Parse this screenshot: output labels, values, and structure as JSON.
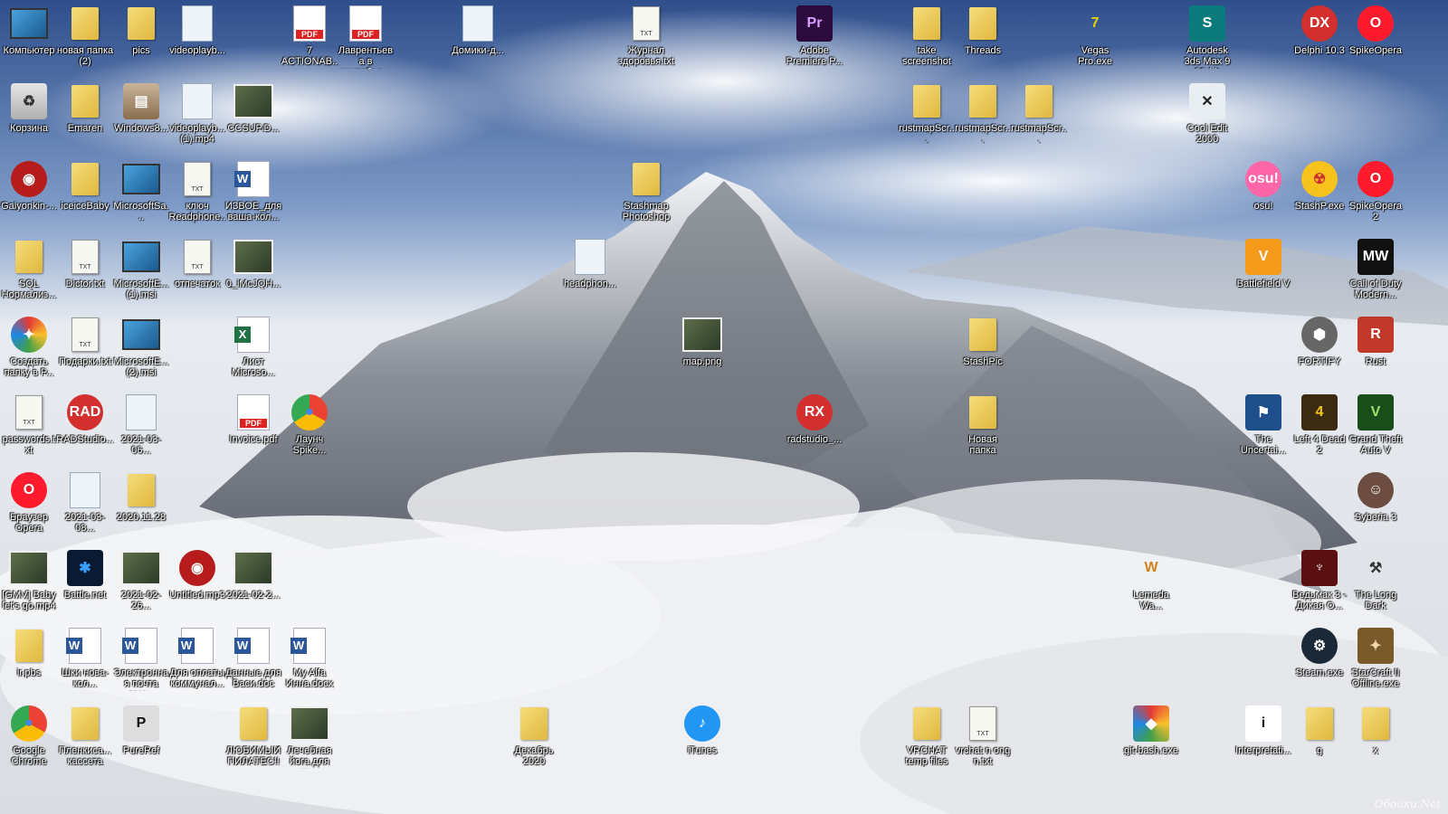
{
  "desktop": {
    "watermark": "Обойки.Net",
    "icons": [
      {
        "label": "Компьютер",
        "icon": "computer-icon"
      },
      {
        "label": "новая папка (2)",
        "icon": "folder-icon"
      },
      {
        "label": "pics",
        "icon": "folder-icon"
      },
      {
        "label": "videoplayb...",
        "icon": "video-file-icon"
      },
      {
        "label": "7 ACTIONAB...",
        "icon": "pdf-icon"
      },
      {
        "label": "Лаврентьева в сентябре...",
        "icon": "pdf-icon"
      },
      {
        "label": "Домики-д...",
        "icon": "presentation-icon"
      },
      {
        "label": "Журнал здоровья.txt",
        "icon": "txt-icon"
      },
      {
        "label": "Adobe Premiere P...",
        "icon": "premiere-icon"
      },
      {
        "label": "take screenshot",
        "icon": "folder-icon"
      },
      {
        "label": "Threads",
        "icon": "folder-icon"
      },
      {
        "label": "Vegas Pro.exe",
        "icon": "vegas-icon"
      },
      {
        "label": "Autodesk 3ds Max 9 32-bit",
        "icon": "3dsmax-icon"
      },
      {
        "label": "Delphi 10.3",
        "icon": "delphi-icon"
      },
      {
        "label": "SpikeOpera",
        "icon": "opera-icon"
      },
      {
        "label": "Корзина",
        "icon": "recycle-bin-icon"
      },
      {
        "label": "Emaren",
        "icon": "folder-icon"
      },
      {
        "label": "Windows8...",
        "icon": "archive-icon"
      },
      {
        "label": "videoplayb... (1).mp4",
        "icon": "video-file-icon"
      },
      {
        "label": "CCSUP.D...",
        "icon": "image-file-icon"
      },
      {
        "label": "rustmapScr...",
        "icon": "folder-icon"
      },
      {
        "label": "rustmapScr...",
        "icon": "folder-icon"
      },
      {
        "label": "rustmapScr...",
        "icon": "folder-icon"
      },
      {
        "label": "Cool Edit 2000",
        "icon": "cooledit-icon"
      },
      {
        "label": "Galyonkin-...",
        "icon": "audio-icon"
      },
      {
        "label": "iceiceBaby",
        "icon": "folder-icon"
      },
      {
        "label": "MicrosoftSa...",
        "icon": "installer-icon"
      },
      {
        "label": "ключ Readphone...",
        "icon": "txt-icon"
      },
      {
        "label": "ИЗВОЕ_для ваша-кол...",
        "icon": "word-icon"
      },
      {
        "label": "Stashmap Photoshop",
        "icon": "folder-icon"
      },
      {
        "label": "osu!",
        "icon": "osu-icon"
      },
      {
        "label": "StashP.exe",
        "icon": "stash-icon"
      },
      {
        "label": "SpikeOpera2",
        "icon": "opera-icon"
      },
      {
        "label": "SQL Нормализ...",
        "icon": "folder-icon"
      },
      {
        "label": "Dictor.txt",
        "icon": "txt-icon"
      },
      {
        "label": "MicrosoftE... (1).msi",
        "icon": "installer-icon"
      },
      {
        "label": "отпечаток",
        "icon": "txt-icon"
      },
      {
        "label": "0_iMcJQH...",
        "icon": "image-file-icon"
      },
      {
        "label": "headphon...",
        "icon": "video-file-icon"
      },
      {
        "label": "Battlefield V",
        "icon": "battlefield-icon"
      },
      {
        "label": "Call of Duty Modern...",
        "icon": "cod-icon"
      },
      {
        "label": "Создать папку в Р...",
        "icon": "shortcut-app-icon"
      },
      {
        "label": "Подарки.txt",
        "icon": "txt-icon"
      },
      {
        "label": "MicrosoftE... (2).msi",
        "icon": "installer-icon"
      },
      {
        "label": "Лист Microsо...",
        "icon": "excel-icon"
      },
      {
        "label": "map.png",
        "icon": "image-file-icon"
      },
      {
        "label": "StashPic",
        "icon": "folder-icon"
      },
      {
        "label": "FORTIFY",
        "icon": "fortify-icon"
      },
      {
        "label": "Rust",
        "icon": "rust-icon"
      },
      {
        "label": "passwords.txt",
        "icon": "txt-icon"
      },
      {
        "label": "RADStudio...",
        "icon": "rad-icon"
      },
      {
        "label": "2021-03-06...",
        "icon": "screenshot-icon"
      },
      {
        "label": "Invoice.pdf",
        "icon": "pdf-icon"
      },
      {
        "label": "Лаунч Spike...",
        "icon": "chrome-icon"
      },
      {
        "label": "radstudio_...",
        "icon": "rx-icon"
      },
      {
        "label": "Новая папка",
        "icon": "folder-icon"
      },
      {
        "label": "The Uncertai...",
        "icon": "game-icon"
      },
      {
        "label": "Left 4 Dead 2",
        "icon": "l4d2-icon"
      },
      {
        "label": "Grand Theft Auto V",
        "icon": "gta-icon"
      },
      {
        "label": "Браузер Opera",
        "icon": "opera-icon"
      },
      {
        "label": "2021-03-08...",
        "icon": "screenshot-icon"
      },
      {
        "label": "2020.11.28",
        "icon": "folder-icon"
      },
      {
        "label": "Syberia 3",
        "icon": "syberia-icon"
      },
      {
        "label": "[GMV] Baby let's go.mp4",
        "icon": "video-thumb-icon"
      },
      {
        "label": "Battle.net",
        "icon": "battlenet-icon"
      },
      {
        "label": "2021-02-26...",
        "icon": "image-file-icon"
      },
      {
        "label": "Untitled.mp3",
        "icon": "audio-icon"
      },
      {
        "label": "2021-02-2...",
        "icon": "image-file-icon"
      },
      {
        "label": "Lemeda Wa...",
        "icon": "wasteland-icon"
      },
      {
        "label": "Ведьмак 3 - Дикая О...",
        "icon": "witcher-icon"
      },
      {
        "label": "The Long Dark",
        "icon": "longdark-icon"
      },
      {
        "label": "ir.pbs",
        "icon": "folder-icon"
      },
      {
        "label": "Шки нова-кол...",
        "icon": "word-icon"
      },
      {
        "label": "Электронная почта дом...",
        "icon": "word-icon"
      },
      {
        "label": "Для оплаты коммунал...",
        "icon": "word-icon"
      },
      {
        "label": "Данные для Васи.doc",
        "icon": "word-icon"
      },
      {
        "label": "My Alfa Инна.docx",
        "icon": "word-icon"
      },
      {
        "label": "Steam.exe",
        "icon": "steam-icon"
      },
      {
        "label": "StarCraft II Offline.exe",
        "icon": "starcraft-icon"
      },
      {
        "label": "Google Chrome",
        "icon": "chrome-icon"
      },
      {
        "label": "Пленкиса... кассета",
        "icon": "folder-icon"
      },
      {
        "label": "PureRef",
        "icon": "pureref-icon"
      },
      {
        "label": "ЛЮБИМЫЙ ПИЛАТЕС!!",
        "icon": "folder-icon"
      },
      {
        "label": "Лечебная йога для ш...",
        "icon": "video-thumb-icon"
      },
      {
        "label": "Декабрь 2020",
        "icon": "folder-icon"
      },
      {
        "label": "iTunes",
        "icon": "itunes-icon"
      },
      {
        "label": "VRCHAT temp files",
        "icon": "folder-icon"
      },
      {
        "label": "vrchat n ong n.txt",
        "icon": "txt-icon"
      },
      {
        "label": "git-bash.exe",
        "icon": "git-icon"
      },
      {
        "label": "Interpretati...",
        "icon": "info-icon"
      },
      {
        "label": "g",
        "icon": "folder-icon"
      },
      {
        "label": "x",
        "icon": "folder-icon"
      }
    ]
  }
}
